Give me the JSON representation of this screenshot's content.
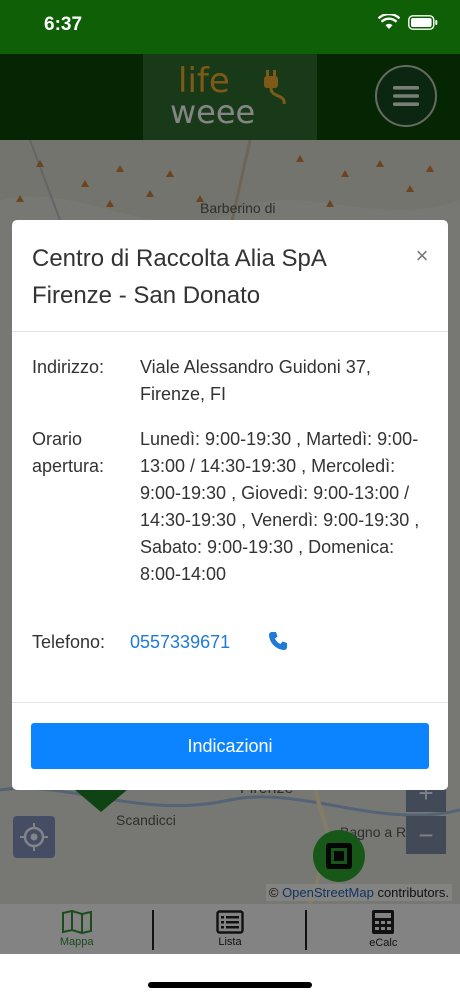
{
  "status_bar": {
    "time": "6:37"
  },
  "header": {
    "logo_line1": "life",
    "logo_line2": "weee",
    "menu_icon": "hamburger-icon"
  },
  "map": {
    "labels": {
      "barberino": "Barberino di",
      "firenze": "Firenze",
      "scandicci": "Scandicci",
      "bagno": "Bagno a Ripoli"
    },
    "attribution": {
      "symbol": "©",
      "link_text": "OpenStreetMap",
      "suffix": " contributors."
    },
    "zoom_in": "+",
    "zoom_out": "−",
    "locate_icon": "crosshair-icon"
  },
  "modal": {
    "title": "Centro di Raccolta Alia SpA Firenze - San Donato",
    "close_label": "×",
    "address_label": "Indirizzo:",
    "address_value": "Viale Alessandro Guidoni 37, Firenze, FI",
    "hours_label": "Orario apertura:",
    "hours_value": "Lunedì: 9:00-19:30 , Martedì: 9:00-13:00 / 14:30-19:30 , Mercoledì: 9:00-19:30 , Giovedì: 9:00-13:00 / 14:30-19:30 , Venerdì: 9:00-19:30 , Sabato: 9:00-19:30 , Domenica: 8:00-14:00",
    "phone_label": "Telefono:",
    "phone_value": "0557339671",
    "phone_icon": "phone-icon",
    "directions_label": "Indicazioni"
  },
  "tabs": [
    {
      "label": "Mappa",
      "icon": "map-icon"
    },
    {
      "label": "Lista",
      "icon": "list-icon"
    },
    {
      "label": "eCalc",
      "icon": "calculator-icon"
    }
  ],
  "colors": {
    "status_bar": "#0e5f06",
    "header": "#0c4507",
    "primary_button": "#0d84ff",
    "link": "#1f7ad8",
    "tab_bar": "#838383"
  }
}
